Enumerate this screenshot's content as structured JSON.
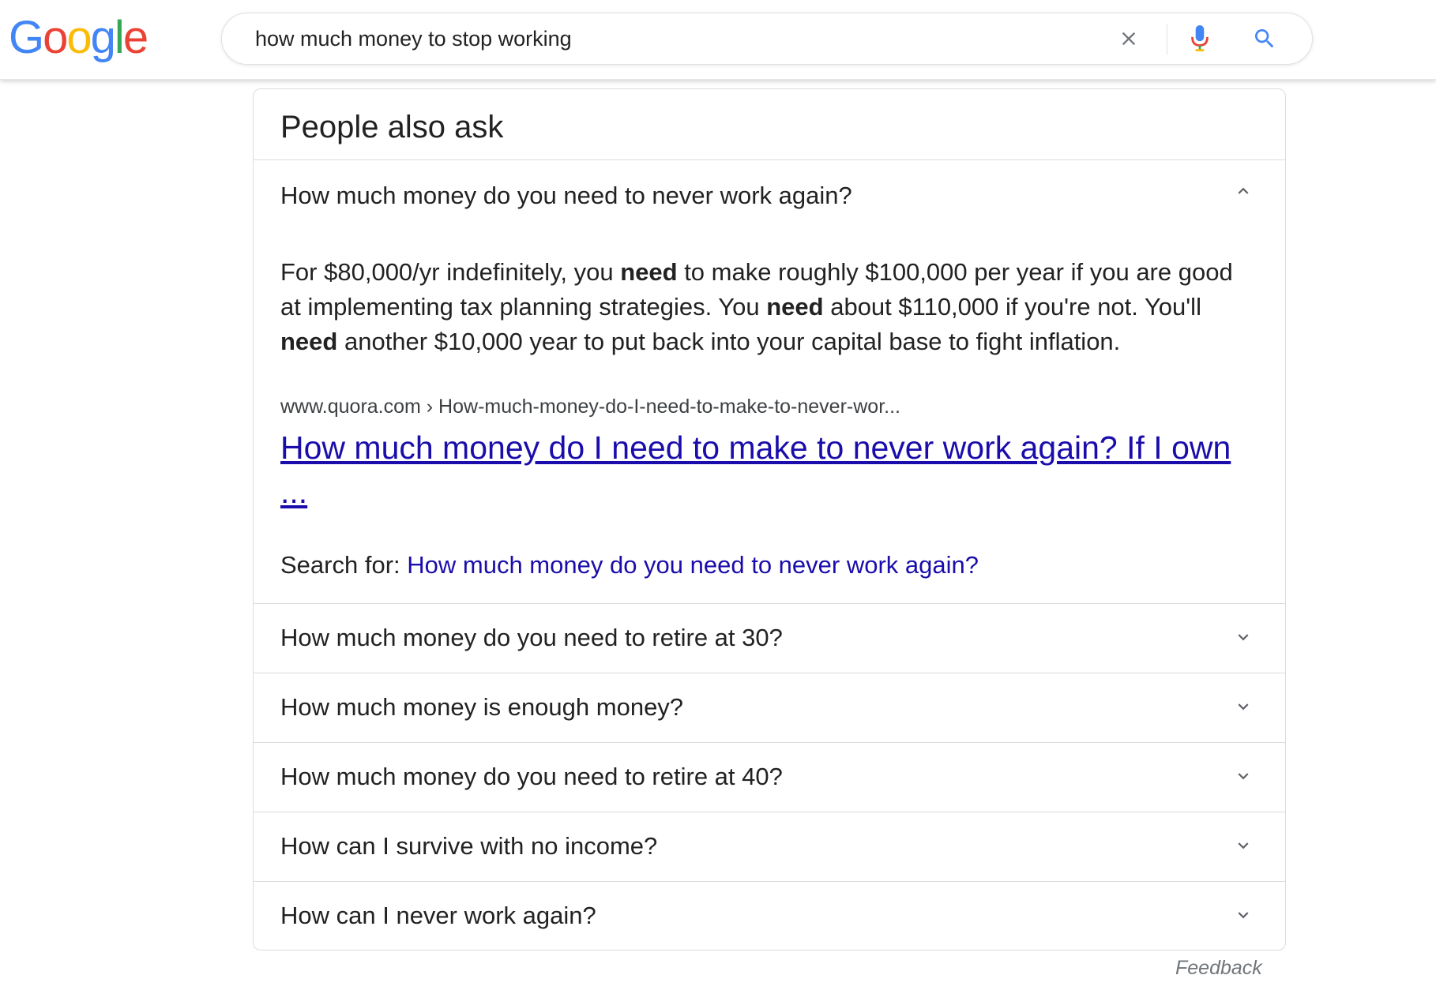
{
  "logo": {
    "letters": [
      "G",
      "o",
      "o",
      "g",
      "l",
      "e"
    ],
    "colors": [
      "#4285F4",
      "#EA4335",
      "#FBBC05",
      "#4285F4",
      "#34A853",
      "#EA4335"
    ]
  },
  "search": {
    "query": "how much money to stop working",
    "clear_icon": "close-icon",
    "mic_icon": "microphone-icon",
    "search_icon": "search-icon"
  },
  "paa": {
    "title": "People also ask",
    "expanded": {
      "question": "How much money do you need to never work again?",
      "answer_parts": [
        "For $80,000/yr indefinitely, you ",
        "need",
        " to make roughly $100,000 per year if you are good at implementing tax planning strategies. You ",
        "need",
        " about $110,000 if you're not. You'll ",
        "need",
        " another $10,000 year to put back into your capital base to fight inflation."
      ],
      "cite": "www.quora.com › How-much-money-do-I-need-to-make-to-never-wor...",
      "link_title": "How much money do I need to make to never work again? If I own ...",
      "search_for_label": "Search for: ",
      "search_for_link": "How much money do you need to never work again?"
    },
    "questions": [
      "How much money do you need to retire at 30?",
      "How much money is enough money?",
      "How much money do you need to retire at 40?",
      "How can I survive with no income?",
      "How can I never work again?"
    ]
  },
  "feedback_label": "Feedback",
  "colors": {
    "link": "#1a0dab",
    "text": "#222222",
    "border": "#dadce0",
    "muted": "#70757a"
  }
}
